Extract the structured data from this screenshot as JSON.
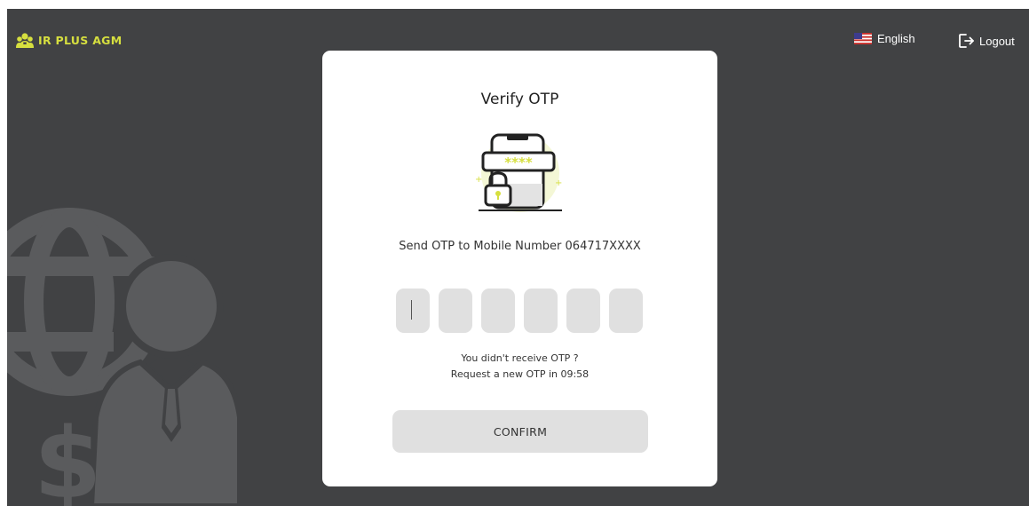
{
  "header": {
    "brand_name": "IR PLUS AGM",
    "brand_icon": "investor-group-icon",
    "language_label": "English",
    "language_icon": "us-flag-icon",
    "logout_label": "Logout",
    "logout_icon": "logout-arrow-icon"
  },
  "card": {
    "title": "Verify OTP",
    "illustration_icon": "phone-password-lock-icon",
    "description": "Send OTP to Mobile Number 064717XXXX",
    "otp_digits": [
      "",
      "",
      "",
      "",
      "",
      ""
    ],
    "resend_question": "You didn't receive OTP ?",
    "resend_timer": "Request a new OTP in 09:58",
    "confirm_label": "CONFIRM"
  },
  "colors": {
    "background": "#414244",
    "brand_accent": "#d6df3f",
    "card": "#ffffff",
    "input_fill": "#e0e0e0"
  }
}
